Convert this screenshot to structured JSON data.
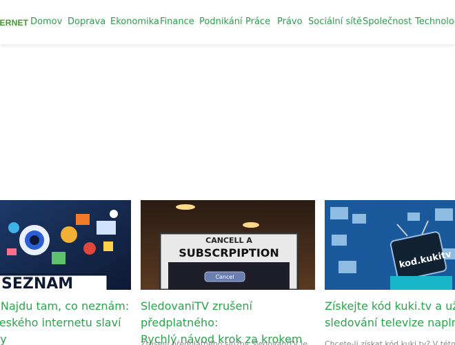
{
  "site": {
    "logo_text": "TERNET"
  },
  "nav": {
    "items": [
      {
        "label": "Domov"
      },
      {
        "label": "Doprava"
      },
      {
        "label": "Ekonomika"
      },
      {
        "label": "Finance"
      },
      {
        "label": "Podnikání"
      },
      {
        "label": "Práce"
      },
      {
        "label": "Právo"
      },
      {
        "label": "Sociální sítě"
      },
      {
        "label": "Společnost"
      },
      {
        "label": "Technolog"
      }
    ]
  },
  "colors": {
    "accent": "#2aa44a",
    "nav": "#2e9c4b",
    "logo": "#3d9a2a"
  },
  "cards": [
    {
      "title": "- Najdu tam, co neznám: českého internetu slaví ny",
      "title_lines": [
        "- Najdu tam, co neznám:",
        "českého internetu slaví",
        "ny"
      ],
      "image_text": "SEZNAM",
      "image_alt": "seznam-illustration",
      "excerpt": ""
    },
    {
      "title": "SledovaniTV zrušení předplatného: Rychlý návod krok za krokem",
      "title_lines": [
        "SledovaniTV zrušení předplatného:",
        "Rychlý návod krok za krokem"
      ],
      "image_text_top": "CANCELL A",
      "image_text_main": "SUBSCRPIPTION",
      "image_button": "Cancel",
      "excerpt": "Zrušení předplatného služby SledovaniTV je..."
    },
    {
      "title": "Získejte kód kuki.tv a užijte si sledování televize naplno!",
      "title_lines": [
        "Získejte kód kuki.tv a užijte",
        "sledování televize naplno!"
      ],
      "image_text": "kod.kukitv",
      "excerpt": "Chcete-li získat kód kuki.tv? V této příručce..."
    }
  ]
}
